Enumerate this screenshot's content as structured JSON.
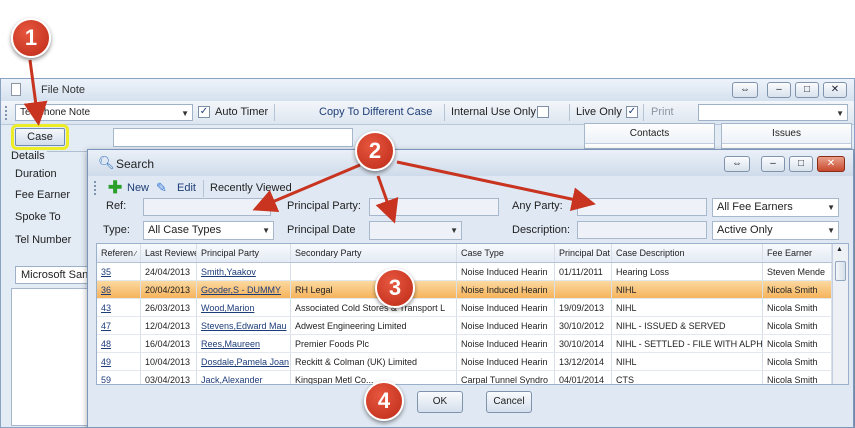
{
  "file_note": {
    "title": "File Note",
    "note_type": "Telephone Note",
    "auto_timer_label": "Auto Timer",
    "auto_timer_checked": true,
    "copy_label": "Copy To Different Case",
    "internal_use_label": "Internal Use Only",
    "internal_use_checked": false,
    "live_only_label": "Live Only",
    "live_only_checked": true,
    "print_label": "Print",
    "case_button": "Case",
    "details_label": "Details",
    "fields": [
      "Duration",
      "Fee Earner",
      "Spoke To",
      "Tel Number"
    ],
    "font_name": "Microsoft Sans",
    "contacts_label": "Contacts",
    "issues_label": "Issues"
  },
  "search": {
    "title": "Search",
    "new_label": "New",
    "edit_label": "Edit",
    "recently_viewed_label": "Recently Viewed",
    "filters": {
      "ref_label": "Ref:",
      "type_label": "Type:",
      "type_value": "All Case Types",
      "principal_party_label": "Principal Party:",
      "principal_date_label": "Principal Date",
      "any_party_label": "Any Party:",
      "description_label": "Description:",
      "fee_earners_value": "All Fee Earners",
      "status_value": "Active Only"
    },
    "columns": [
      "Referen",
      "Last Reviewe",
      "Principal Party",
      "Secondary Party",
      "Case Type",
      "Principal Dat",
      "Case Description",
      "Fee Earner"
    ],
    "rows": [
      [
        "35",
        "24/04/2013",
        "Smith,Yaakov",
        "",
        "Noise Induced Hearin",
        "01/11/2011",
        "Hearing Loss",
        "Steven Mende"
      ],
      [
        "36",
        "20/04/2013",
        "Gooder,S - DUMMY",
        "RH Legal",
        "Noise Induced Hearin",
        "",
        "NIHL",
        "Nicola Smith"
      ],
      [
        "43",
        "26/03/2013",
        "Wood,Marion",
        "Associated Cold Stores & Transport L",
        "Noise Induced Hearin",
        "19/09/2013",
        "NIHL",
        "Nicola Smith"
      ],
      [
        "47",
        "12/04/2013",
        "Stevens,Edward Mau",
        "Adwest Engineering Limited",
        "Noise Induced Hearin",
        "30/10/2012",
        "NIHL - ISSUED & SERVED",
        "Nicola Smith"
      ],
      [
        "48",
        "16/04/2013",
        "Rees,Maureen",
        "Premier Foods Plc",
        "Noise Induced Hearin",
        "30/10/2014",
        "NIHL - SETTLED - FILE WITH ALPH",
        "Nicola Smith"
      ],
      [
        "49",
        "10/04/2013",
        "Dosdale,Pamela Joan",
        "Reckitt & Colman (UK) Limited",
        "Noise Induced Hearin",
        "13/12/2014",
        "NIHL",
        "Nicola Smith"
      ],
      [
        "59",
        "03/04/2013",
        "Jack,Alexander",
        "Kingspan Metl Co...",
        "Carpal Tunnel Syndro",
        "04/01/2014",
        "CTS",
        "Nicola Smith"
      ]
    ],
    "selected_row": 1,
    "ok_label": "OK",
    "cancel_label": "Cancel"
  },
  "callouts": [
    "1",
    "2",
    "3",
    "4"
  ],
  "colors": {
    "callout": "#c8341f",
    "highlight": "#ecec27",
    "selected_row": "#f6b35c"
  }
}
